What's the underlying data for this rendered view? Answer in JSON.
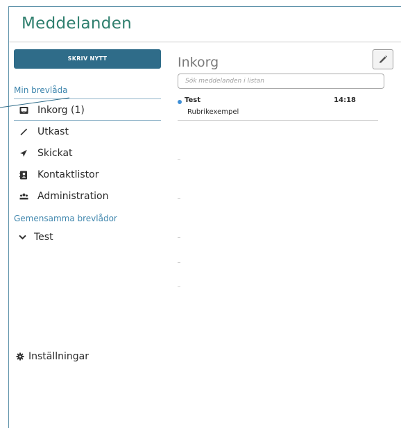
{
  "app": {
    "title": "Meddelanden"
  },
  "sidebar": {
    "compose_label": "SKRIV NYTT",
    "my_mailbox_label": "Min brevlåda",
    "items": [
      {
        "label": "Inkorg (1)",
        "icon": "inbox-icon"
      },
      {
        "label": "Utkast",
        "icon": "pencil-icon"
      },
      {
        "label": "Skickat",
        "icon": "paper-plane-icon"
      },
      {
        "label": "Kontaktlistor",
        "icon": "contact-book-icon"
      },
      {
        "label": "Administration",
        "icon": "users-icon"
      }
    ],
    "shared_mailboxes_label": "Gemensamma brevlådor",
    "shared_items": [
      {
        "label": "Test",
        "icon": "chevron-down-icon"
      }
    ],
    "settings_label": "Inställningar"
  },
  "main": {
    "title": "Inkorg",
    "search_placeholder": "Sök meddelanden i listan",
    "messages": [
      {
        "sender": "Test",
        "time": "14:18",
        "subject": "Rubrikexempel",
        "unread": true
      }
    ]
  },
  "colors": {
    "title": "#2f7f6e",
    "compose_button": "#2f6c89",
    "section_label": "#3f86ad",
    "unread_dot": "#3f8fd6"
  }
}
